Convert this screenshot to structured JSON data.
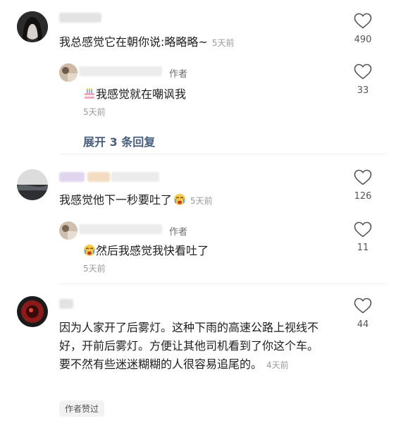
{
  "comments": [
    {
      "text": "我总感觉它在朝你说:略略略~",
      "time": "5天前",
      "likes": "490",
      "reply": {
        "tag": "作者",
        "text": "我感觉就在嘲讽我",
        "time": "5天前",
        "likes": "33"
      },
      "expand": "展开 3 条回复"
    },
    {
      "text": "我感觉他下一秒要吐了",
      "time": "5天前",
      "likes": "126",
      "reply": {
        "tag": "作者",
        "text": "然后我感觉我快看吐了",
        "time": "5天前",
        "likes": "11"
      }
    },
    {
      "text": "因为人家开了后雾灯。这种下雨的高速公路上视线不好，开前后雾灯。方便让其他司机看到了你这个车。要不然有些迷迷糊糊的人很容易追尾的。",
      "time": "4天前",
      "likes": "44",
      "badge": "作者赞过"
    }
  ],
  "icons": {
    "heart": "heart-outline-icon",
    "emoji_crying": "crying-face-emoji-icon",
    "emoji_cake": "birthday-cake-emoji-icon"
  },
  "colors": {
    "link": "#4a5f7e",
    "muted": "#9a9a9a",
    "text": "#1d1d1d"
  }
}
